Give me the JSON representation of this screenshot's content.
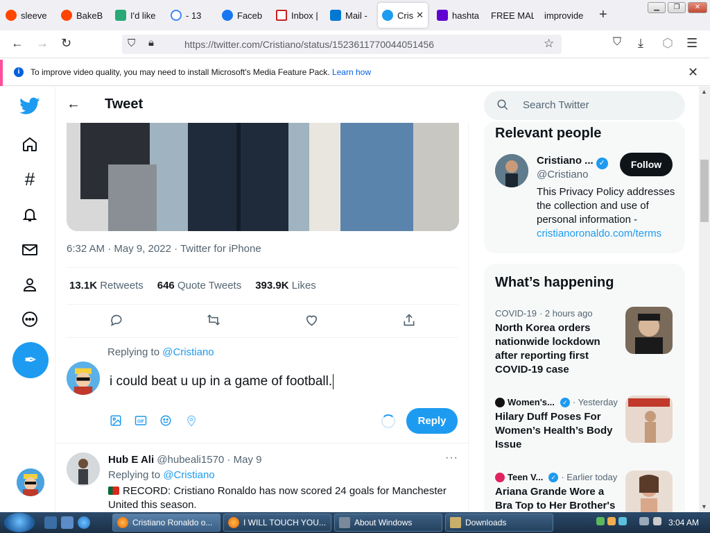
{
  "browser": {
    "tabs": [
      {
        "label": "sleeve",
        "color": "#ff4500"
      },
      {
        "label": "BakeB",
        "color": "#ff4500"
      },
      {
        "label": "I'd like",
        "color": "#2aa876"
      },
      {
        "label": "- 13",
        "color": "#4285f4"
      },
      {
        "label": "Faceb",
        "color": "#1877f2"
      },
      {
        "label": "Inbox |",
        "color": "#c5221f"
      },
      {
        "label": "Mail -",
        "color": "#0078d4"
      },
      {
        "label": "Cris",
        "color": "#1d9bf0",
        "active": true
      },
      {
        "label": "hashta",
        "color": "#6001d2"
      },
      {
        "label": "FREE MAL",
        "color": ""
      },
      {
        "label": "improvide",
        "color": ""
      }
    ],
    "url": "https://twitter.com/Cristiano/status/1523611770044051456",
    "infobar_text": "To improve video quality, you may need to install Microsoft's Media Feature Pack.",
    "infobar_link": "Learn how"
  },
  "tweet_page": {
    "header_title": "Tweet",
    "meta": "6:32 AM · May 9, 2022 · Twitter for iPhone",
    "stats": {
      "retweets_count": "13.1K",
      "retweets_label": "Retweets",
      "quotes_count": "646",
      "quotes_label": "Quote Tweets",
      "likes_count": "393.9K",
      "likes_label": "Likes"
    },
    "compose": {
      "replying_prefix": "Replying to",
      "replying_handle": "@Cristiano",
      "text": "i could beat u up in a game of football.",
      "reply_button": "Reply"
    },
    "reply": {
      "name": "Hub E Ali",
      "handle": "@hubeali1570",
      "date": "· May 9",
      "more": "···",
      "replying_prefix": "Replying to",
      "replying_handle": "@Cristiano",
      "text": "RECORD: Cristiano Ronaldo has now scored 24 goals for Manchester United this season."
    }
  },
  "sidebar": {
    "search_placeholder": "Search Twitter",
    "relevant_people": {
      "title": "Relevant people",
      "name": "Cristiano ...",
      "handle": "@Cristiano",
      "follow": "Follow",
      "bio": "This Privacy Policy addresses the collection and use of personal information -",
      "bio_link": "cristianoronaldo.com/terms"
    },
    "whats_happening": {
      "title": "What’s happening",
      "items": [
        {
          "source": "COVID-19",
          "time": "· 2 hours ago",
          "title": "North Korea orders nationwide lockdown after reporting first COVID-19 case"
        },
        {
          "source": "Women's...",
          "time": "· Yesterday",
          "title": "Hilary Duff Poses For Women’s Health’s Body Issue"
        },
        {
          "source": "Teen V...",
          "time": "· Earlier today",
          "title": "Ariana Grande Wore a Bra Top to Her Brother's"
        }
      ]
    }
  },
  "taskbar": {
    "tasks": [
      {
        "label": "Cristiano Ronaldo o...",
        "active": true
      },
      {
        "label": "I WILL TOUCH YOU...",
        "active": false
      },
      {
        "label": "About Windows",
        "active": false
      },
      {
        "label": "Downloads",
        "active": false
      }
    ],
    "clock": "3:04 AM"
  },
  "colors": {
    "twitter_blue": "#1d9bf0",
    "accent_pink": "#ff4f9a"
  }
}
